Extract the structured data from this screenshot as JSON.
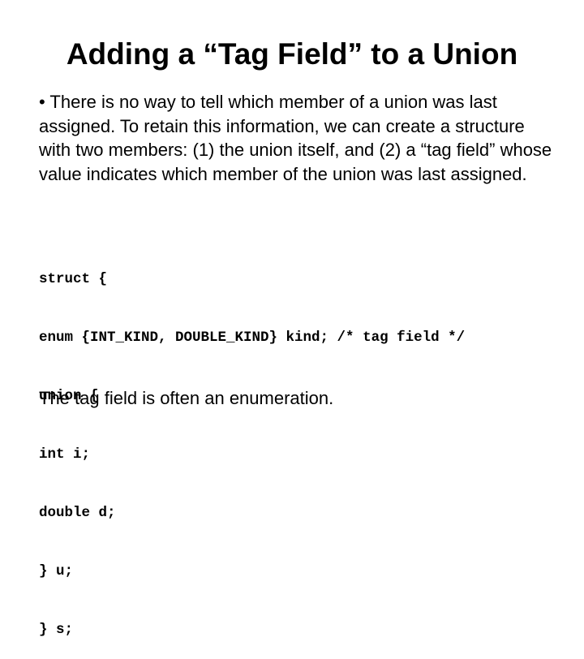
{
  "slide": {
    "title": "Adding a “Tag Field” to a Union",
    "bullet": "• There is no way to tell which member of a union was last assigned. To retain this information, we can create a structure with two members: (1) the union itself, and (2) a “tag field” whose value indicates which member of the union was last assigned.",
    "code_lines": [
      "struct {",
      "enum {INT_KIND, DOUBLE_KIND} kind; /* tag field */",
      "union {",
      "int i;",
      "double d;",
      "} u;",
      "} s;"
    ],
    "footer": "The tag field is often an enumeration."
  }
}
